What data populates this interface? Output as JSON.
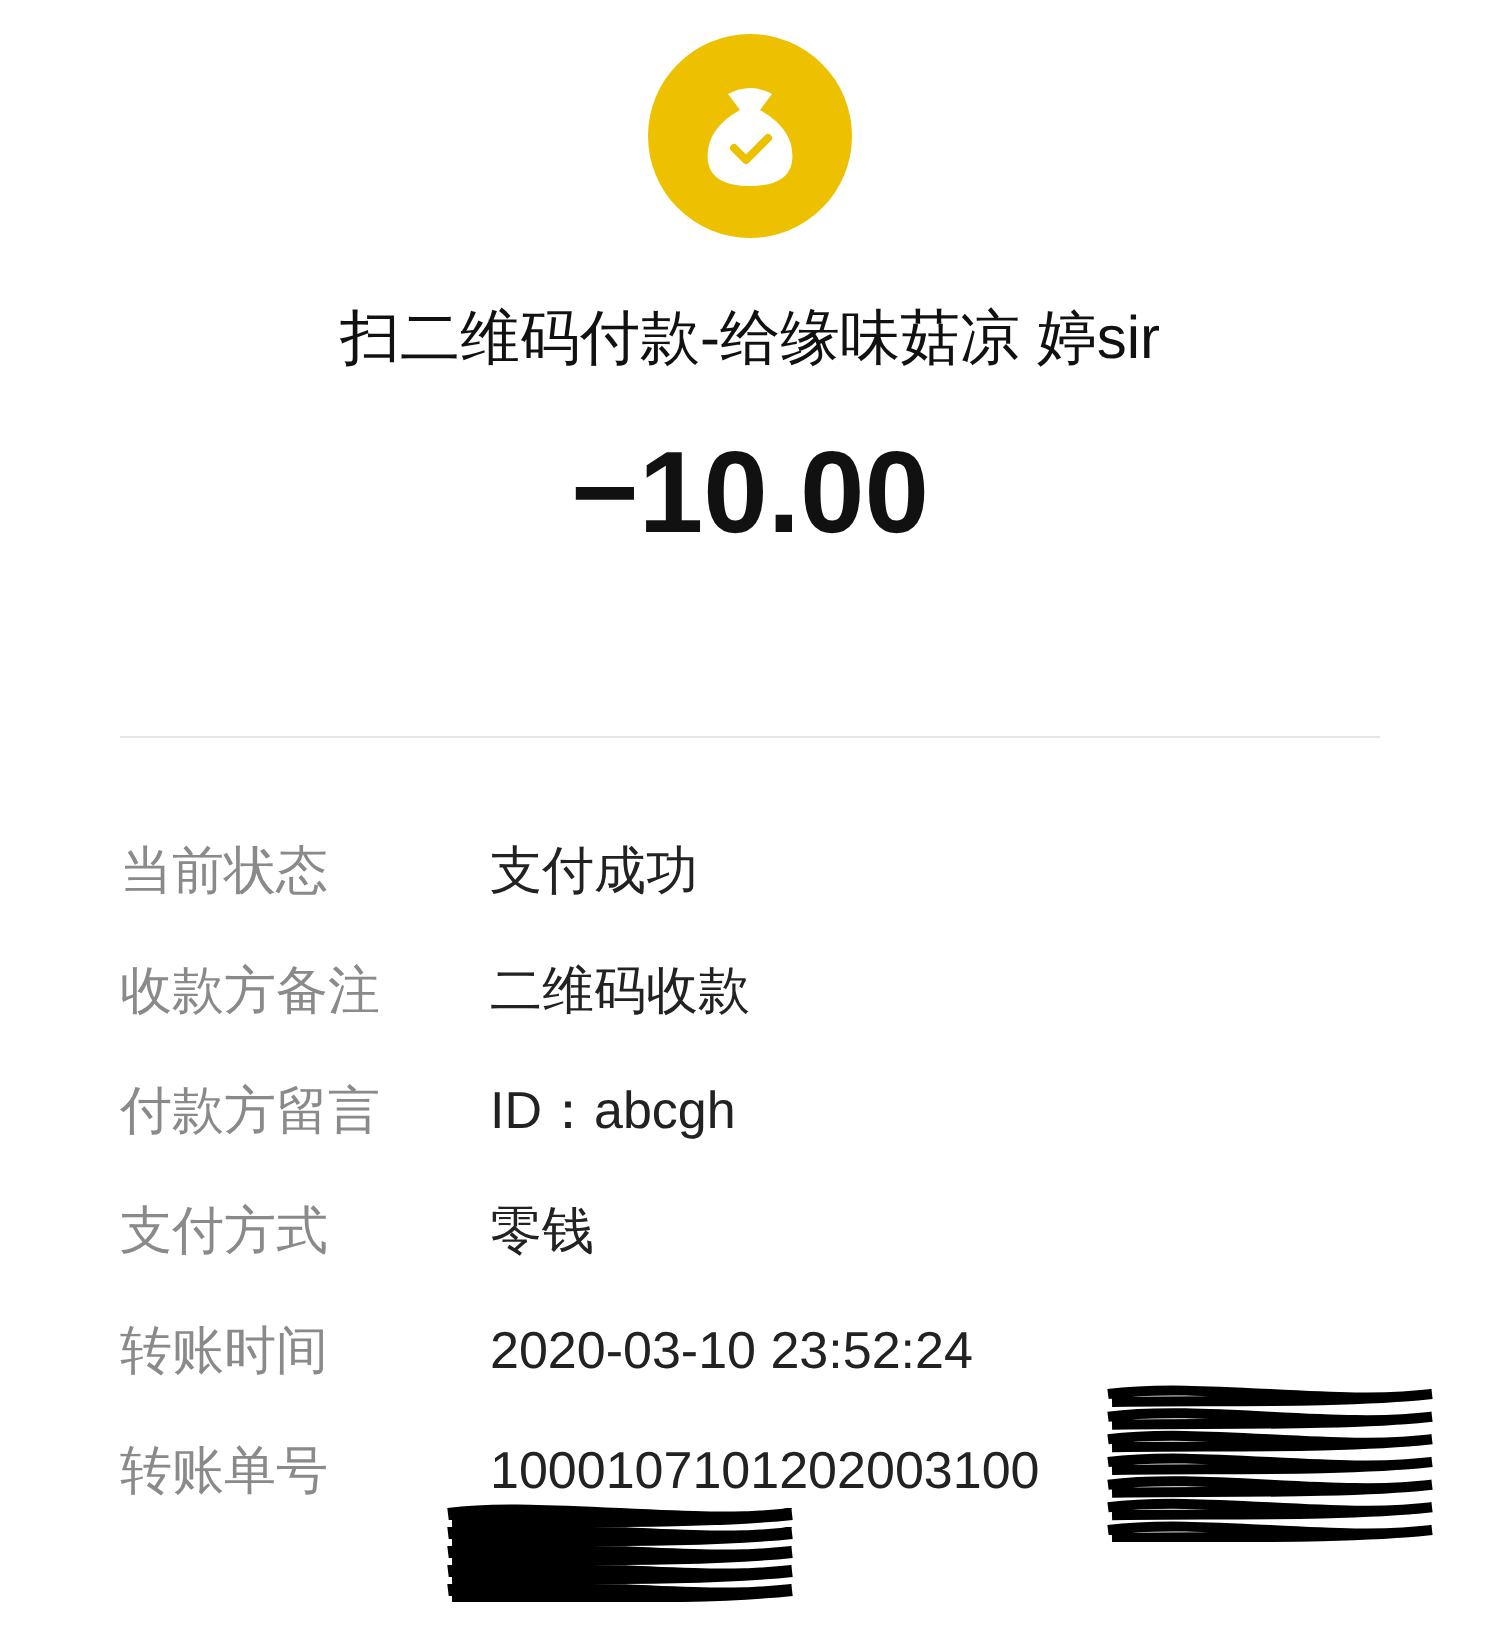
{
  "title": "扫二维码付款-给缘味菇凉 婷sir",
  "amount": "−10.00",
  "details": [
    {
      "label": "当前状态",
      "value": "支付成功"
    },
    {
      "label": "收款方备注",
      "value": "二维码收款"
    },
    {
      "label": "付款方留言",
      "value": "ID：abcgh"
    },
    {
      "label": "支付方式",
      "value": "零钱"
    },
    {
      "label": "转账时间",
      "value": "2020-03-10 23:52:24"
    },
    {
      "label": "转账单号",
      "value": "1000107101202003100",
      "redacted": true
    }
  ]
}
